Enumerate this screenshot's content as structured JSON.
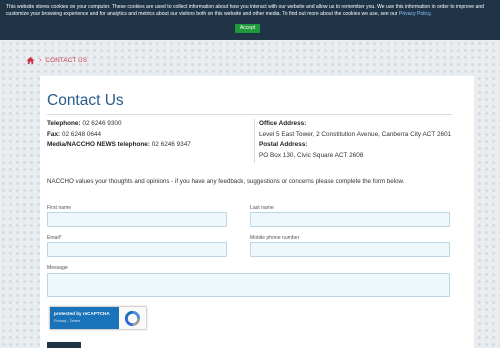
{
  "cookie_banner": {
    "text": "This website stores cookies on your computer. These cookies are used to collect information about how you interact with our website and allow us to remember you. We use this information in order to improve and customize your browsing experience and for analytics and metrics about our visitors both on this website and other media. To find out more about the cookies we use, see our",
    "policy_link": "Privacy Policy",
    "policy_suffix": ".",
    "accept_label": "Accept",
    "accept_color": "#1f9a3a"
  },
  "breadcrumb": {
    "home_icon": "home-icon",
    "separator": "›",
    "current": "CONTACT US"
  },
  "page": {
    "title": "Contact Us"
  },
  "contact": {
    "telephone_label": "Telephone:",
    "telephone": "02 6246 9300",
    "fax_label": "Fax:",
    "fax": "02 6248 0644",
    "media_label": "Media/NACCHO NEWS telephone:",
    "media": "02 6246 9347",
    "office_label": "Office Address:",
    "office": "Level 5 East Tower, 2 Constitution Avenue, Canberra City ACT 2601",
    "postal_label": "Postal Address:",
    "postal": "PO Box 130, Civic Square ACT 2608"
  },
  "intro": "NACCHO values your thoughts and opinions - if you have any feedback, suggestions or concerns please complete the form below.",
  "form": {
    "first_name_label": "First name",
    "first_name_value": "",
    "last_name_label": "Last name",
    "last_name_value": "",
    "email_label": "Email",
    "email_required": "*",
    "email_value": "",
    "mobile_label": "Mobile phone number",
    "mobile_value": "",
    "message_label": "Message",
    "message_value": ""
  },
  "recaptcha": {
    "label": "protected by reCAPTCHA",
    "privacy": "Privacy",
    "separator": " - ",
    "terms": "Terms"
  },
  "colors": {
    "accent_title": "#2a5a8a",
    "breadcrumb": "#c9364b",
    "banner_bg": "#1f3446",
    "field_bg": "#eef7fb"
  }
}
